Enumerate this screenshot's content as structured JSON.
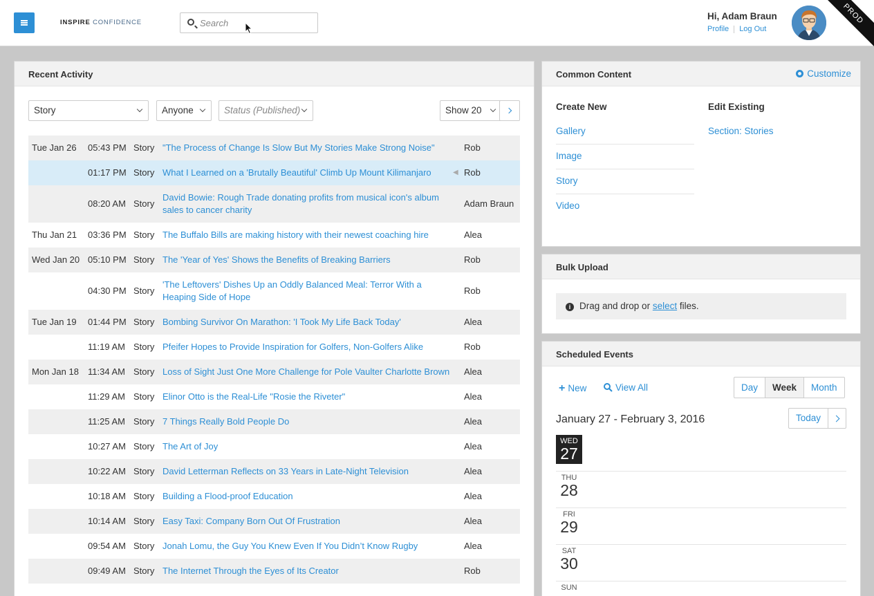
{
  "header": {
    "logo_bold": "INSPIRE",
    "logo_light": "CONFIDENCE",
    "search_placeholder": "Search",
    "greeting": "Hi, Adam Braun",
    "profile_link": "Profile",
    "logout_link": "Log Out",
    "env_badge": "PROD"
  },
  "recent": {
    "title": "Recent Activity",
    "filter_type": "Story",
    "filter_user": "Anyone",
    "filter_status": "Status (Published)",
    "page_size": "Show 20",
    "rows": [
      {
        "date": "Tue Jan 26",
        "time": "05:43 PM",
        "type": "Story",
        "title": "\"The Process of Change Is Slow But My Stories Make Strong Noise\"",
        "author": "Rob"
      },
      {
        "date": "",
        "time": "01:17 PM",
        "type": "Story",
        "title": "What I Learned on a 'Brutally Beautiful' Climb Up Mount Kilimanjaro",
        "author": "Rob"
      },
      {
        "date": "",
        "time": "08:20 AM",
        "type": "Story",
        "title": "David Bowie: Rough Trade donating profits from musical icon's album sales to cancer charity",
        "author": "Adam Braun"
      },
      {
        "date": "Thu Jan 21",
        "time": "03:36 PM",
        "type": "Story",
        "title": "The Buffalo Bills are making history with their newest coaching hire",
        "author": "Alea"
      },
      {
        "date": "Wed Jan 20",
        "time": "05:10 PM",
        "type": "Story",
        "title": "The 'Year of Yes' Shows the Benefits of Breaking Barriers",
        "author": "Rob"
      },
      {
        "date": "",
        "time": "04:30 PM",
        "type": "Story",
        "title": "'The Leftovers' Dishes Up an Oddly Balanced Meal: Terror With a Heaping Side of Hope",
        "author": "Rob"
      },
      {
        "date": "Tue Jan 19",
        "time": "01:44 PM",
        "type": "Story",
        "title": "Bombing Survivor On Marathon: 'I Took My Life Back Today'",
        "author": "Alea"
      },
      {
        "date": "",
        "time": "11:19 AM",
        "type": "Story",
        "title": "Pfeifer Hopes to Provide Inspiration for Golfers, Non-Golfers Alike",
        "author": "Rob"
      },
      {
        "date": "Mon Jan 18",
        "time": "11:34 AM",
        "type": "Story",
        "title": "Loss of Sight Just One More Challenge for Pole Vaulter Charlotte Brown",
        "author": "Alea"
      },
      {
        "date": "",
        "time": "11:29 AM",
        "type": "Story",
        "title": "Elinor Otto is the Real-Life \"Rosie the Riveter\"",
        "author": "Alea"
      },
      {
        "date": "",
        "time": "11:25 AM",
        "type": "Story",
        "title": "7 Things Really Bold People Do",
        "author": "Alea"
      },
      {
        "date": "",
        "time": "10:27 AM",
        "type": "Story",
        "title": "The Art of Joy",
        "author": "Alea"
      },
      {
        "date": "",
        "time": "10:22 AM",
        "type": "Story",
        "title": "David Letterman Reflects on 33 Years in Late-Night Television",
        "author": "Alea"
      },
      {
        "date": "",
        "time": "10:18 AM",
        "type": "Story",
        "title": "Building a Flood-proof Education",
        "author": "Alea"
      },
      {
        "date": "",
        "time": "10:14 AM",
        "type": "Story",
        "title": "Easy Taxi: Company Born Out Of Frustration",
        "author": "Alea"
      },
      {
        "date": "",
        "time": "09:54 AM",
        "type": "Story",
        "title": "Jonah Lomu, the Guy You Knew Even If You Didn’t Know Rugby",
        "author": "Alea"
      },
      {
        "date": "",
        "time": "09:49 AM",
        "type": "Story",
        "title": "The Internet Through the Eyes of Its Creator",
        "author": "Rob"
      }
    ]
  },
  "common": {
    "title": "Common Content",
    "customize": "Customize",
    "create_heading": "Create New",
    "create_items": [
      "Gallery",
      "Image",
      "Story",
      "Video"
    ],
    "edit_heading": "Edit Existing",
    "edit_items": [
      "Section: Stories"
    ]
  },
  "bulk": {
    "title": "Bulk Upload",
    "text_before": "Drag and drop or",
    "link": "select",
    "text_after": "files."
  },
  "events": {
    "title": "Scheduled Events",
    "new_label": "New",
    "view_all_label": "View All",
    "views": [
      "Day",
      "Week",
      "Month"
    ],
    "active_view": "Week",
    "range": "January 27 - February 3, 2016",
    "today_label": "Today",
    "days": [
      {
        "name": "WED",
        "num": "27",
        "today": true
      },
      {
        "name": "THU",
        "num": "28",
        "today": false
      },
      {
        "name": "FRI",
        "num": "29",
        "today": false
      },
      {
        "name": "SAT",
        "num": "30",
        "today": false
      },
      {
        "name": "SUN",
        "num": "",
        "today": false
      }
    ]
  },
  "colors": {
    "accent": "#2d8fd5",
    "highlight_row": "#d8ecf8"
  }
}
